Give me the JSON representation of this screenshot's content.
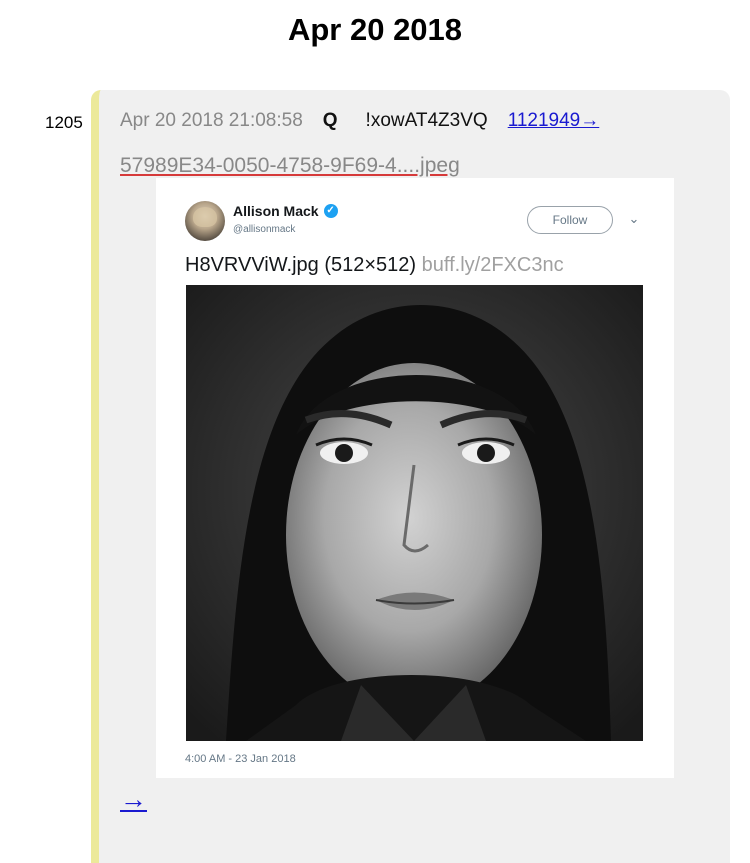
{
  "page": {
    "title": "Apr 20 2018"
  },
  "post": {
    "number": "1205",
    "date": "Apr 20 2018 21:08:58",
    "name": "Q",
    "tripcode": "!xowAT4Z3VQ",
    "reference": "1121949→",
    "file_name": "57989E34-0050-4758-9F69-4....jpeg",
    "next_arrow": "→"
  },
  "tweet": {
    "author_name": "Allison Mack",
    "author_handle": "@allisonmack",
    "follow_label": "Follow",
    "text_file": "H8VRVViW.jpg (512×512)",
    "text_link": "buff.ly/2FXC3nc",
    "timestamp": "4:00 AM - 23 Jan 2018",
    "verified_glyph": "✓",
    "chevron_glyph": "⌄",
    "verified_color": "#1da1f2"
  },
  "colors": {
    "card_background": "#f0f0f0",
    "card_accent": "#ece99a",
    "link": "#1a1ad0"
  }
}
